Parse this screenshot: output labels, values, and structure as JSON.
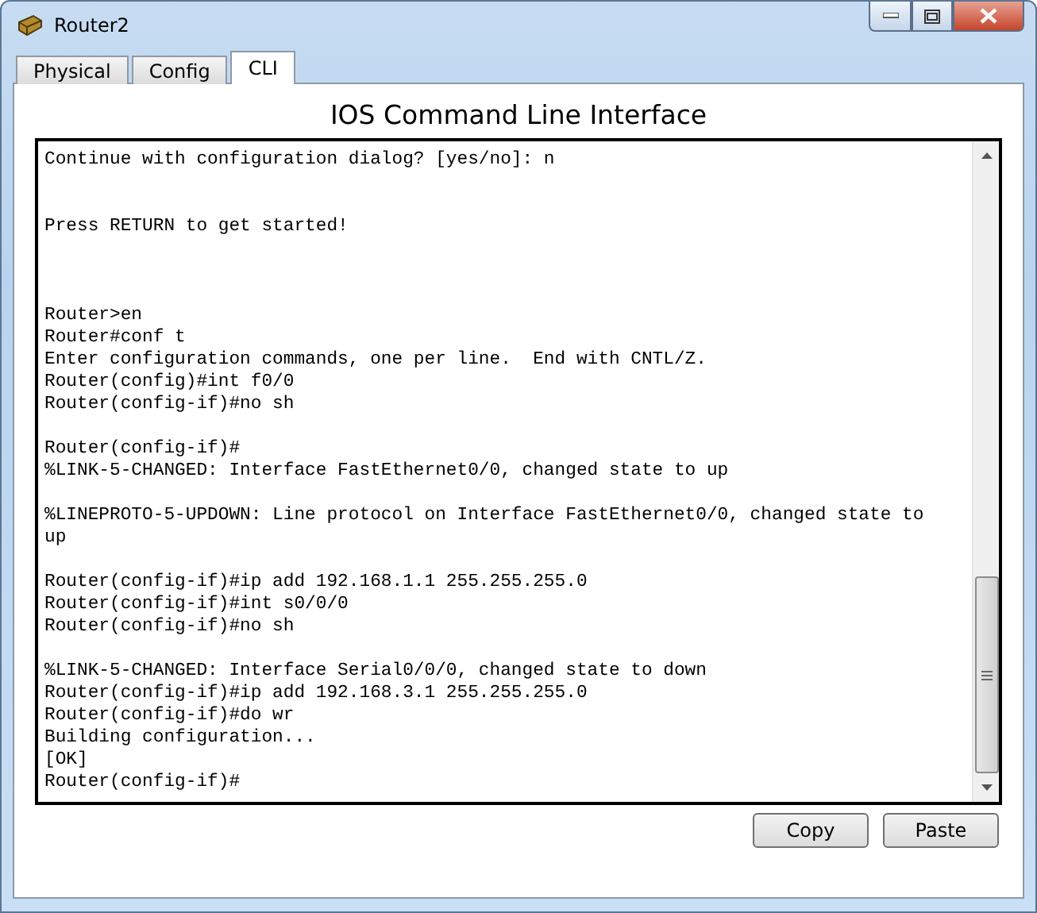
{
  "window": {
    "title": "Router2"
  },
  "tabs": [
    {
      "label": "Physical",
      "selected": false
    },
    {
      "label": "Config",
      "selected": false
    },
    {
      "label": "CLI",
      "selected": true
    }
  ],
  "heading": "IOS Command Line Interface",
  "terminal": {
    "lines": [
      {
        "kind": "text",
        "text": "Continue with configuration dialog? [yes/no]: n"
      },
      {
        "kind": "blank"
      },
      {
        "kind": "blank"
      },
      {
        "kind": "text",
        "text": "Press RETURN to get started!"
      },
      {
        "kind": "blank"
      },
      {
        "kind": "blank"
      },
      {
        "kind": "blank"
      },
      {
        "kind": "text",
        "text": "Router>en"
      },
      {
        "kind": "text",
        "text": "Router#conf t"
      },
      {
        "kind": "text",
        "text": "Enter configuration commands, one per line.  End with CNTL/Z."
      },
      {
        "kind": "text",
        "text": "Router(config)#int f0/0"
      },
      {
        "kind": "text",
        "text": "Router(config-if)#no sh"
      },
      {
        "kind": "blank"
      },
      {
        "kind": "text",
        "text": "Router(config-if)#"
      },
      {
        "kind": "text",
        "text": "%LINK-5-CHANGED: Interface FastEthernet0/0, changed state to up"
      },
      {
        "kind": "blank"
      },
      {
        "kind": "text",
        "text": "%LINEPROTO-5-UPDOWN: Line protocol on Interface FastEthernet0/0, changed state to"
      },
      {
        "kind": "text",
        "text": "up"
      },
      {
        "kind": "blank"
      },
      {
        "kind": "text",
        "text": "Router(config-if)#ip add 192.168.1.1 255.255.255.0"
      },
      {
        "kind": "text",
        "text": "Router(config-if)#int s0/0/0"
      },
      {
        "kind": "text",
        "text": "Router(config-if)#no sh"
      },
      {
        "kind": "blank"
      },
      {
        "kind": "text",
        "text": "%LINK-5-CHANGED: Interface Serial0/0/0, changed state to down"
      },
      {
        "kind": "text",
        "text": "Router(config-if)#ip add 192.168.3.1 255.255.255.0"
      },
      {
        "kind": "text",
        "text": "Router(config-if)#do wr"
      },
      {
        "kind": "text",
        "text": "Building configuration..."
      },
      {
        "kind": "text",
        "text": "[OK]"
      },
      {
        "kind": "text",
        "text": "Router(config-if)#"
      }
    ]
  },
  "buttons": [
    "Copy",
    "Paste"
  ]
}
